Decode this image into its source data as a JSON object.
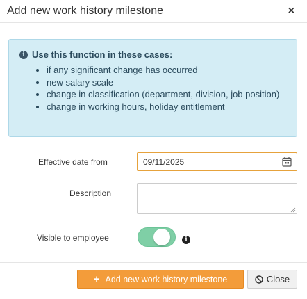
{
  "dialog": {
    "title": "Add new work history milestone",
    "close_glyph": "×"
  },
  "info": {
    "icon": "info-circle-icon",
    "icon_glyph": "i",
    "title": "Use this function in these cases:",
    "items": [
      "if any significant change has occurred",
      "new salary scale",
      "change in classification (department, division, job position)",
      "change in working hours, holiday entitlement"
    ]
  },
  "form": {
    "effective_date_label": "Effective date from",
    "effective_date_value": "09/11/2025",
    "description_label": "Description",
    "description_value": "",
    "visible_label": "Visible to employee",
    "visible_on": true,
    "visible_info_glyph": "i"
  },
  "buttons": {
    "add_plus": "+",
    "add_label": "Add new work history milestone",
    "close_label": "Close"
  },
  "colors": {
    "accent": "#f39c3a",
    "info_bg": "#d4edf5",
    "toggle_on": "#7fcfa6",
    "focus_border": "#e6a23c"
  }
}
